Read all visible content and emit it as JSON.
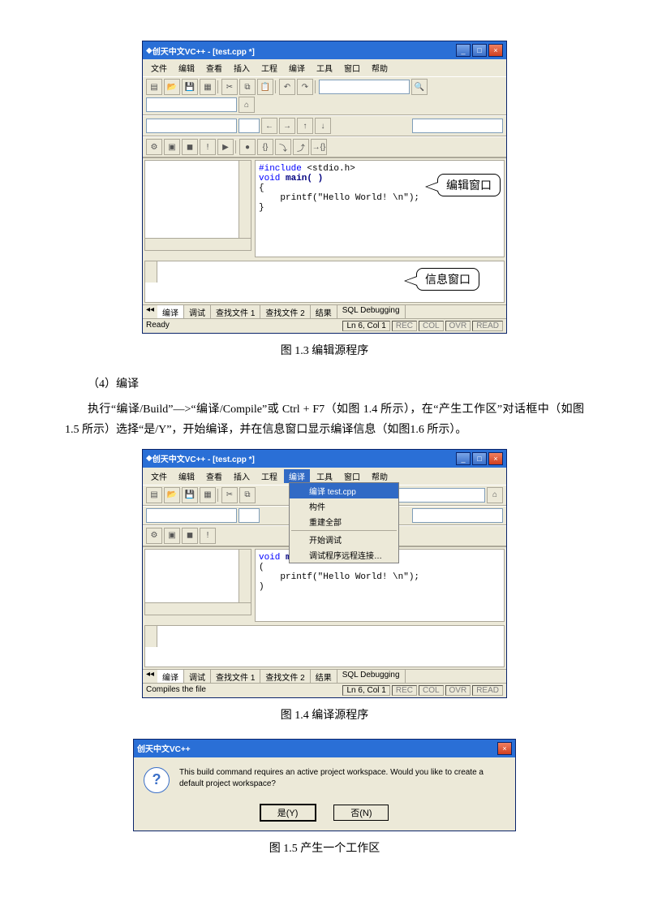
{
  "fig1": {
    "title": "创天中文VC++ - [test.cpp *]",
    "menus": [
      "文件",
      "编辑",
      "查看",
      "插入",
      "工程",
      "编译",
      "工具",
      "窗口",
      "帮助"
    ],
    "code": {
      "l1a": "#include",
      "l1b": " <stdio.h>",
      "l2a": "void",
      "l2b": " main( )",
      "l3": "{",
      "l4": "    printf(\"Hello World! \\n\");",
      "l5": "}"
    },
    "callout_edit": "编辑窗口",
    "callout_info": "信息窗口",
    "tabs": [
      "编译",
      "调试",
      "查找文件 1",
      "查找文件 2",
      "结果",
      "SQL Debugging"
    ],
    "status_ready": "Ready",
    "status_pos": "Ln 6, Col 1",
    "status_flags": [
      "REC",
      "COL",
      "OVR",
      "READ"
    ],
    "caption": "图 1.3   编辑源程序"
  },
  "para": {
    "h": "（4）编译",
    "body": "执行“编译/Build”—>“编译/Compile”或 Ctrl + F7（如图 1.4 所示），在“产生工作区”对话框中（如图 1.5 所示）选择“是/Y”，开始编译，并在信息窗口显示编译信息（如图1.6 所示）。"
  },
  "fig2": {
    "title": "创天中文VC++ - [test.cpp *]",
    "menus": [
      "文件",
      "编辑",
      "查看",
      "插入",
      "工程",
      "编译",
      "工具",
      "窗口",
      "帮助"
    ],
    "dropdown": {
      "sel": "编译 test.cpp",
      "items": [
        "构件",
        "重建全部"
      ],
      "items2": [
        "开始调试",
        "调试程序远程连接…"
      ]
    },
    "code": {
      "l2a": "void",
      "l2b": " main( )",
      "l3": "(",
      "l4": "    printf(\"Hello World! \\n\");",
      "l5": ")"
    },
    "tabs": [
      "编译",
      "调试",
      "查找文件 1",
      "查找文件 2",
      "结果",
      "SQL Debugging"
    ],
    "status_main": "Compiles the file",
    "status_pos": "Ln 6, Col 1",
    "status_flags": [
      "REC",
      "COL",
      "OVR",
      "READ"
    ],
    "caption": "图 1.4   编译源程序"
  },
  "fig3": {
    "title": "创天中文VC++",
    "msg": "This build command requires an active project workspace. Would you like to create a default project workspace?",
    "yes": "是(Y)",
    "no": "否(N)",
    "caption": "图 1.5   产生一个工作区"
  }
}
